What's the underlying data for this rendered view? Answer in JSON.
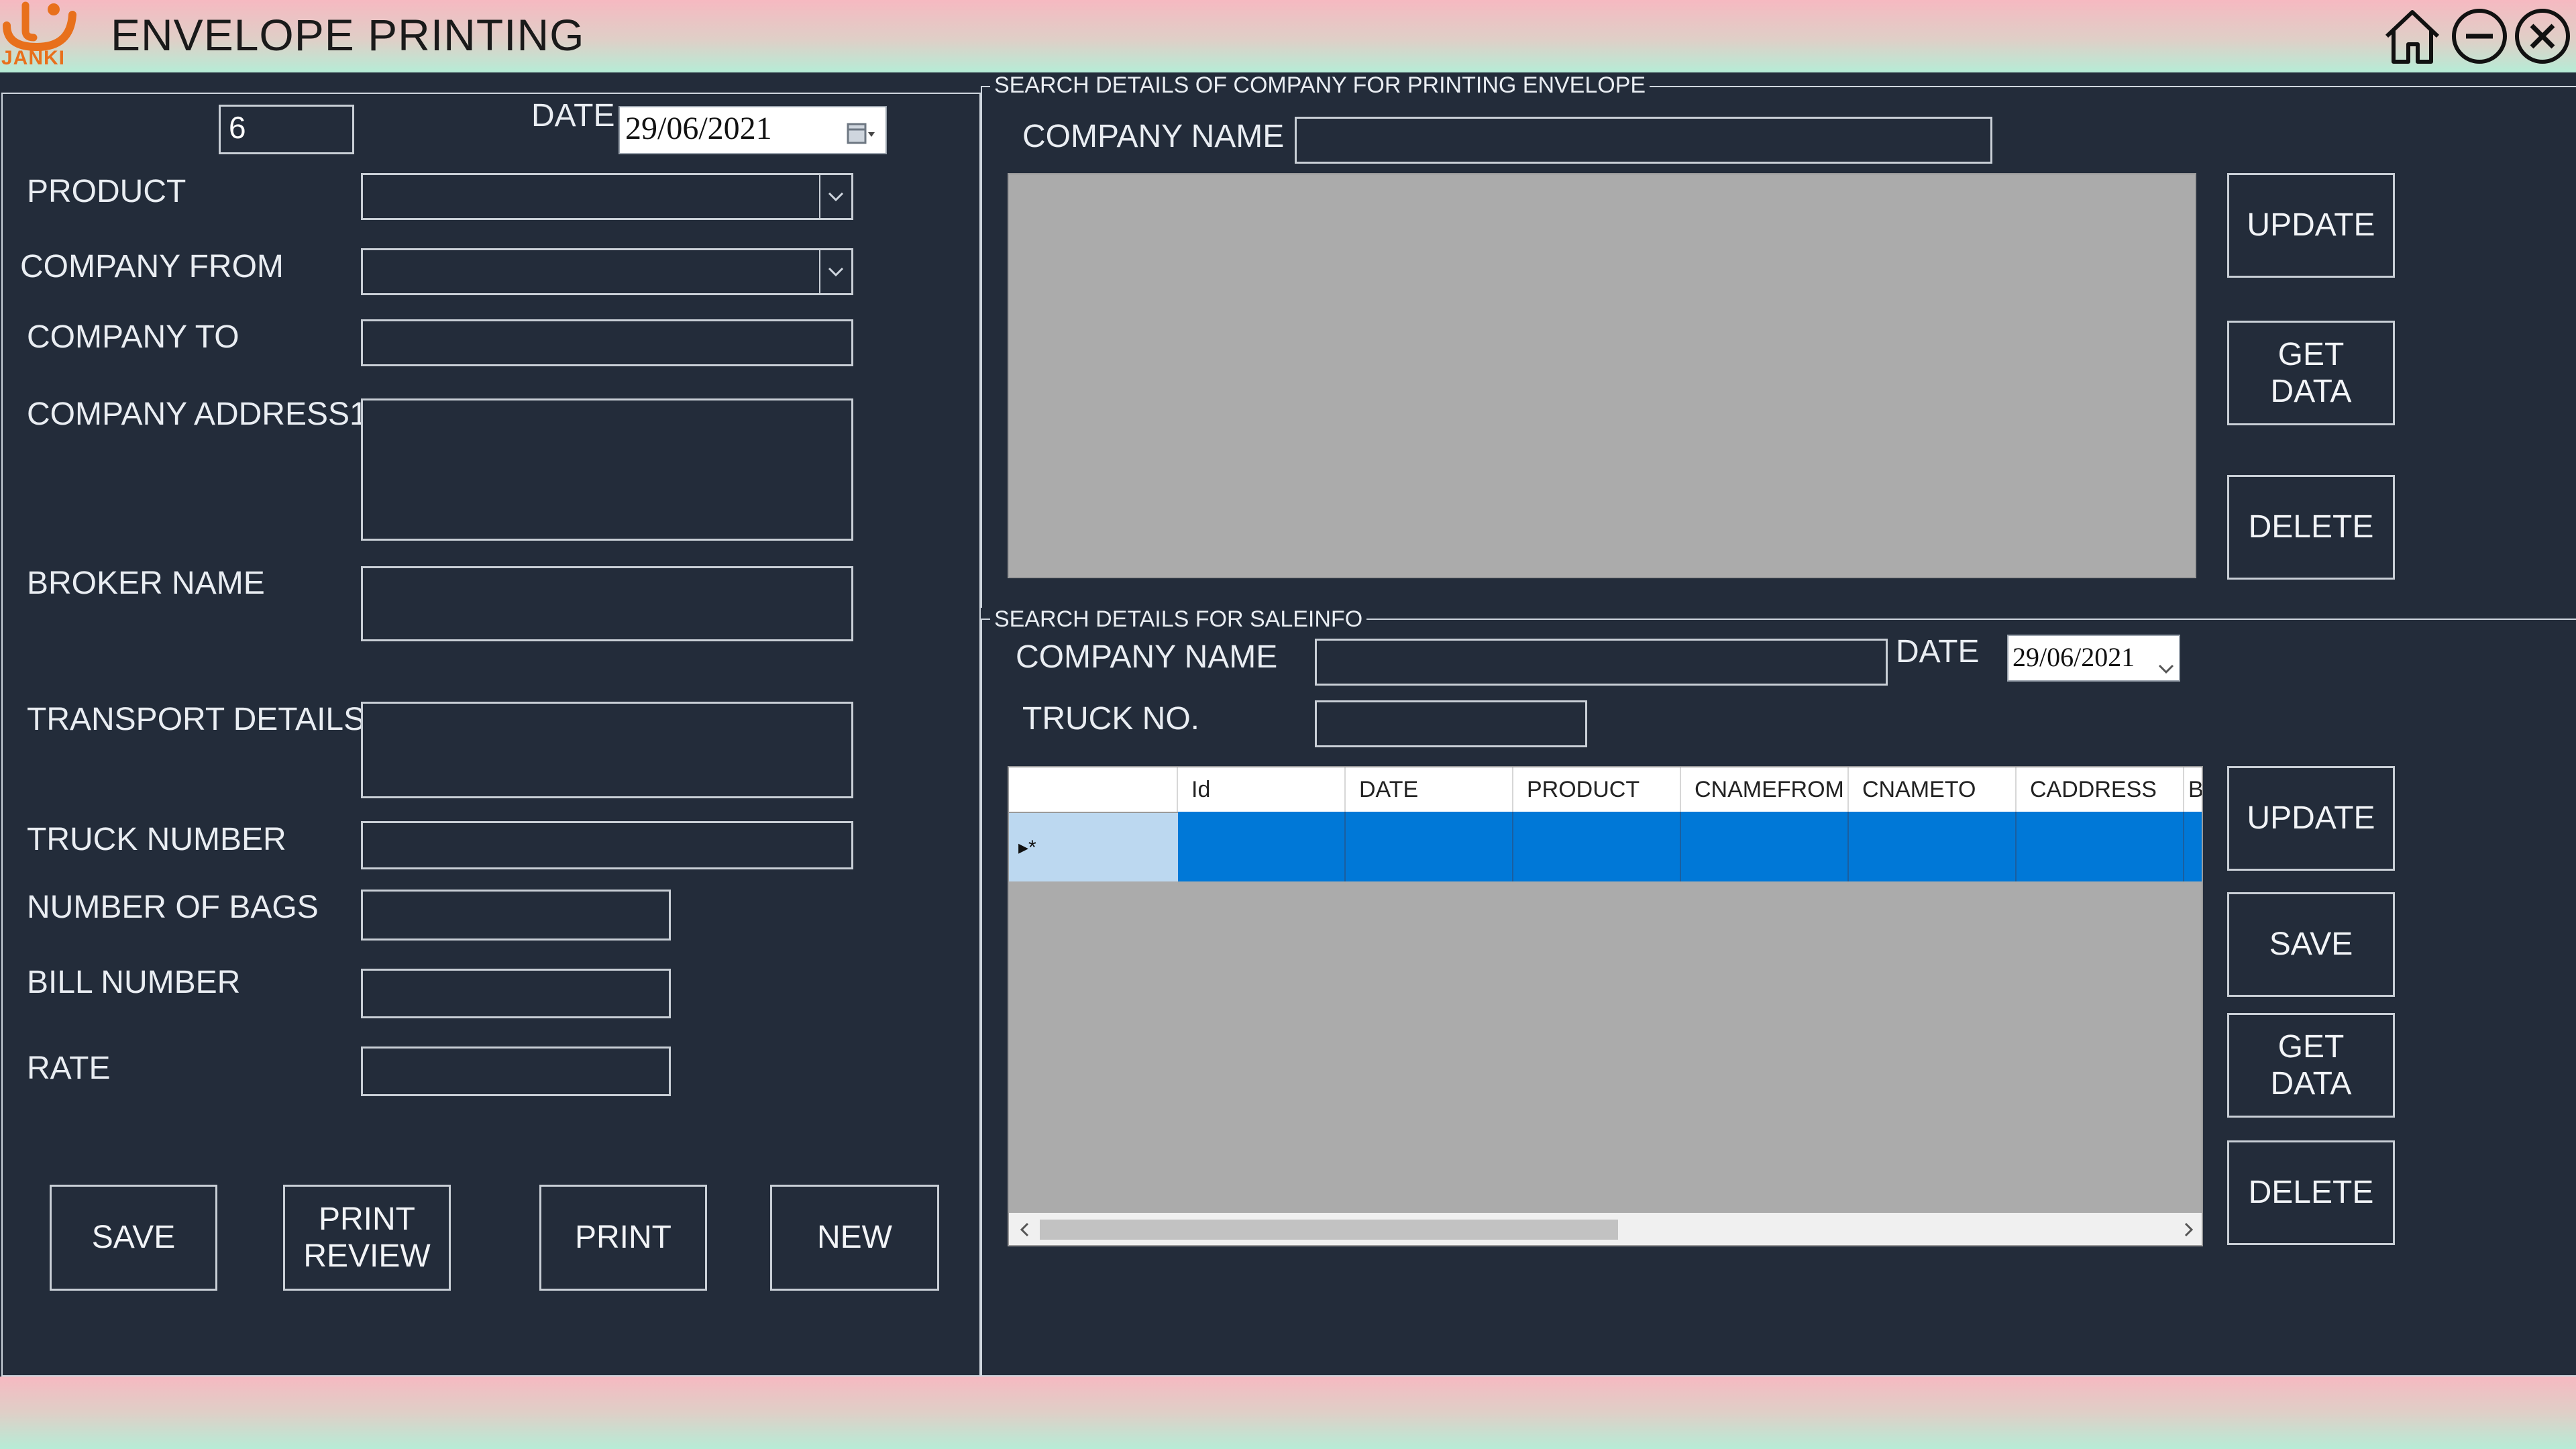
{
  "app": {
    "title": "ENVELOPE PRINTING",
    "logo_text": "JANKI"
  },
  "colors": {
    "background": "#232c3a",
    "header_gradient": [
      "#f6b9c1",
      "#b6ecd6"
    ],
    "grid_selection": "#0078d7",
    "grid_background": "#ababab"
  },
  "window_controls": {
    "icons": [
      "home-icon",
      "minimize-icon",
      "close-icon"
    ]
  },
  "form": {
    "id_value": "6",
    "date_label": "DATE",
    "date_value": "29/06/2021",
    "product_label": "PRODUCT",
    "product_value": "",
    "company_from_label": "COMPANY FROM",
    "company_from_value": "",
    "company_to_label": "COMPANY TO",
    "company_to_value": "",
    "company_address_label": "COMPANY ADDRESS1",
    "company_address_value": "",
    "broker_name_label": "BROKER NAME",
    "broker_name_value": "",
    "transport_details_label": "TRANSPORT DETAILS",
    "transport_details_value": "",
    "truck_number_label": "TRUCK NUMBER",
    "truck_number_value": "",
    "number_of_bags_label": "NUMBER OF BAGS",
    "number_of_bags_value": "",
    "bill_number_label": "BILL NUMBER",
    "bill_number_value": "",
    "rate_label": "RATE",
    "rate_value": "",
    "buttons": {
      "save": "SAVE",
      "print_review": "PRINT REVIEW",
      "print": "PRINT",
      "new": "NEW"
    }
  },
  "company_search": {
    "legend": "SEARCH DETAILS OF COMPANY FOR PRINTING ENVELOPE",
    "company_name_label": "COMPANY NAME",
    "company_name_value": "",
    "buttons": {
      "update": "UPDATE",
      "get_data": "GET DATA",
      "delete": "DELETE"
    }
  },
  "sale_search": {
    "legend": "SEARCH DETAILS FOR SALEINFO",
    "company_name_label": "COMPANY NAME",
    "company_name_value": "",
    "date_label": "DATE",
    "date_value": "29/06/2021",
    "truck_no_label": "TRUCK NO.",
    "truck_no_value": "",
    "grid": {
      "columns": [
        "Id",
        "DATE",
        "PRODUCT",
        "CNAMEFROM",
        "CNAMETO",
        "CADDRESS",
        "B"
      ],
      "new_row_marker": "▸*"
    },
    "buttons": {
      "update": "UPDATE",
      "save": "SAVE",
      "get_data": "GET DATA",
      "delete": "DELETE"
    }
  }
}
